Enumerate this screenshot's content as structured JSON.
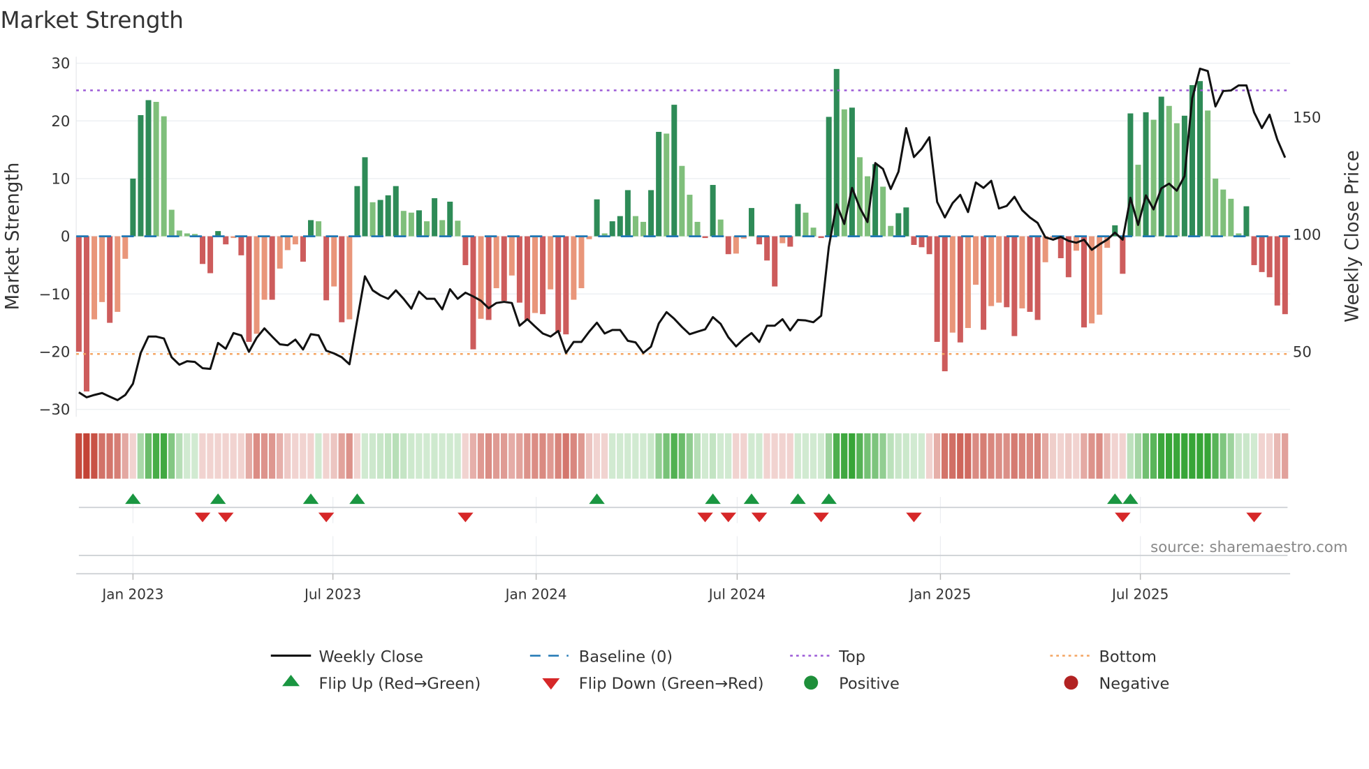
{
  "chart_data": {
    "type": "bar",
    "title": "Market Strength",
    "ylabel": "Market Strength",
    "y2label": "Weekly Close Price",
    "ylim": [
      -30,
      30
    ],
    "y2lim": [
      25.3,
      172.9
    ],
    "yticks": [
      30,
      20,
      10,
      0,
      -10,
      -20,
      -30
    ],
    "ytick_labels": [
      "30",
      "20",
      "10",
      "0",
      "−10",
      "−20",
      "−30"
    ],
    "y2ticks": [
      150,
      100,
      50
    ],
    "y2tick_labels": [
      "150",
      "100",
      "50"
    ],
    "start_week": "2022-11-13",
    "interval_days": 7,
    "xticks": [
      {
        "date": "2023-01-01",
        "label": "Jan 2023"
      },
      {
        "date": "2023-07-01",
        "label": "Jul 2023"
      },
      {
        "date": "2024-01-01",
        "label": "Jan 2024"
      },
      {
        "date": "2024-07-01",
        "label": "Jul 2024"
      },
      {
        "date": "2025-01-01",
        "label": "Jan 2025"
      },
      {
        "date": "2025-07-01",
        "label": "Jul 2025"
      }
    ],
    "top_level": 25.3,
    "bottom_level": -20.4,
    "baseline": 0,
    "strength": [
      -20,
      -26.9,
      -14.4,
      -11.4,
      -15,
      -13.1,
      -3.9,
      10,
      21,
      23.6,
      23.3,
      20.8,
      4.6,
      1.0,
      0.5,
      0.4,
      -4.8,
      -6.4,
      0.9,
      -1.4,
      -0.3,
      -3.3,
      -18.3,
      -16.9,
      -11,
      -11,
      -5.6,
      -2.4,
      -1.4,
      -4.4,
      2.8,
      2.6,
      -11.1,
      -8.7,
      -14.9,
      -14.4,
      8.7,
      13.7,
      5.9,
      6.3,
      7.1,
      8.7,
      4.4,
      4.1,
      4.5,
      2.6,
      6.6,
      2.8,
      6.0,
      2.7,
      -5.0,
      -19.6,
      -14.3,
      -14.5,
      -9,
      -11.2,
      -6.8,
      -11.5,
      -14.5,
      -13.3,
      -13.5,
      -9.2,
      -16.6,
      -17,
      -11,
      -9,
      -0.5,
      6.4,
      0.5,
      2.6,
      3.5,
      8,
      3.5,
      2.5,
      8,
      18.1,
      17.8,
      22.8,
      12.2,
      7.2,
      2.5,
      -0.3,
      8.9,
      2.9,
      -3.1,
      -3.0,
      -0.4,
      4.9,
      -1.4,
      -4.2,
      -8.7,
      -1.2,
      -1.8,
      5.6,
      4.1,
      1.5,
      -0.3,
      20.7,
      29,
      22,
      22.3,
      13.7,
      10.4,
      12.5,
      8.6,
      1.8,
      4.0,
      5,
      -1.5,
      -1.9,
      -3.1,
      -18.3,
      -23.4,
      -16.7,
      -18.4,
      -15.9,
      -8.4,
      -16.2,
      -12.1,
      -11.5,
      -12.3,
      -17.3,
      -12.5,
      -13.1,
      -14.5,
      -4.5,
      -0.3,
      -3.8,
      -7.1,
      -2.5,
      -15.8,
      -15.1,
      -13.6,
      -2,
      1.9,
      -6.5,
      21.3,
      12.4,
      21.5,
      20.2,
      24.2,
      22.6,
      19.6,
      20.9,
      26.2,
      26.9,
      21.8,
      10,
      8.1,
      6.5,
      0.5,
      5.2,
      -5,
      -6.2,
      -7.1,
      -12,
      -13.5
    ],
    "weekly_close": [
      32.7,
      30.6,
      31.6,
      32.4,
      30.9,
      29.4,
      31.6,
      36.4,
      49.5,
      56.5,
      56.5,
      55.7,
      47.7,
      44.5,
      46,
      45.7,
      43,
      42.7,
      53.8,
      51.3,
      58,
      57,
      50,
      56,
      60,
      56.5,
      53.2,
      52.8,
      55.2,
      51,
      57.5,
      57,
      50.5,
      49.3,
      47.7,
      44.7,
      63.6,
      82.2,
      76.2,
      74.1,
      72.6,
      76.2,
      72.6,
      68.4,
      75.7,
      72.6,
      72.6,
      68.1,
      76.7,
      72.6,
      75.2,
      73.6,
      71.8,
      68.6,
      70.8,
      71.3,
      70.8,
      61.1,
      63.9,
      60.8,
      57.8,
      56.5,
      58.9,
      49.5,
      54.2,
      54.2,
      58.6,
      62.4,
      57.8,
      59.3,
      59.3,
      54.7,
      54,
      49.5,
      52.2,
      62.1,
      66.9,
      64.1,
      60.6,
      57.5,
      58.6,
      59.6,
      64.8,
      61.9,
      56.2,
      52.3,
      55.5,
      58,
      54.2,
      61.1,
      61.1,
      63.9,
      59.1,
      63.6,
      63.4,
      62.6,
      65.4,
      94.8,
      112.9,
      104.5,
      119.9,
      111.4,
      105.3,
      130.5,
      128,
      119.4,
      126.8,
      145.4,
      133,
      136.5,
      141.5,
      113.9,
      107.3,
      113.4,
      116.9,
      109.6,
      122.2,
      119.9,
      122.9,
      111.1,
      112.2,
      116.1,
      110.4,
      107.3,
      105,
      98.8,
      97.8,
      99,
      97.3,
      96.5,
      97.8,
      93.5,
      95.8,
      97.8,
      100.8,
      97.8,
      115.7,
      104.1,
      116.7,
      110.7,
      119.7,
      121.7,
      118.7,
      124.9,
      158.1,
      170.7,
      169.7,
      154.6,
      161.2,
      161.4,
      163.6,
      163.6,
      152.1,
      145.4,
      151.1,
      140.5,
      132.8
    ],
    "flip_up_weeks": [
      7,
      18,
      30,
      36,
      67,
      82,
      87,
      93,
      97,
      134,
      136
    ],
    "flip_down_weeks": [
      16,
      19,
      32,
      50,
      81,
      84,
      88,
      96,
      108,
      135,
      152
    ],
    "legend": {
      "placement": "bottom",
      "items": [
        {
          "key": "close",
          "label": "Weekly Close"
        },
        {
          "key": "baseline",
          "label": "Baseline (0)"
        },
        {
          "key": "top",
          "label": "Top"
        },
        {
          "key": "bottom",
          "label": "Bottom"
        },
        {
          "key": "flip_up",
          "label": "Flip Up (Red→Green)"
        },
        {
          "key": "flip_down",
          "label": "Flip Down (Green→Red)"
        },
        {
          "key": "positive",
          "label": "Positive"
        },
        {
          "key": "negative",
          "label": "Negative"
        }
      ]
    },
    "colors": {
      "pos_dark": "#2e8b57",
      "pos_light": "#7fbf7b",
      "neg_dark": "#cd5c5c",
      "neg_light": "#e9967a",
      "close": "#111111",
      "baseline": "#1f77b4",
      "top": "#9b59d6",
      "bottom": "#f4a460",
      "flip_up": "#1a9641",
      "flip_down": "#d62728",
      "positive": "#1e8f3a",
      "negative": "#b22222",
      "strip_pos": "#2ca02c",
      "strip_neg": "#c0392b"
    },
    "source": "source: sharemaestro.com"
  }
}
